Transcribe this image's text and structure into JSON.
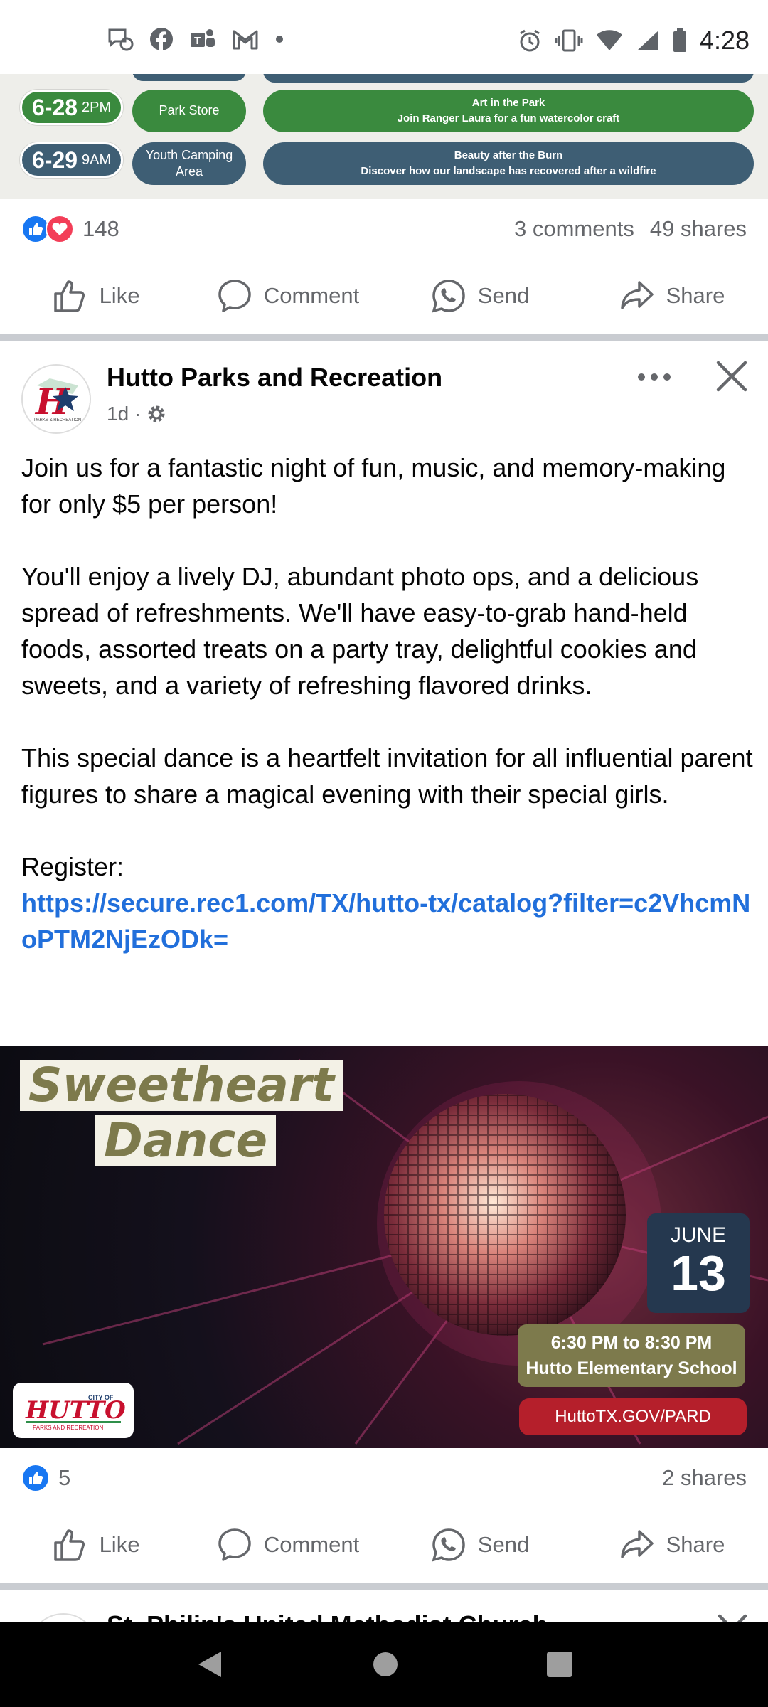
{
  "status_bar": {
    "time": "4:28",
    "left_icons": [
      "messenger-icon",
      "facebook-icon",
      "teams-icon",
      "gmail-icon",
      "dot-icon"
    ],
    "right_icons": [
      "alarm-icon",
      "vibrate-icon",
      "wifi-icon",
      "signal-icon",
      "battery-icon"
    ]
  },
  "prev_post": {
    "schedule": [
      {
        "date": "6-28",
        "time": "2PM",
        "location": "Park Store",
        "title": "Art in the Park",
        "desc": "Join Ranger Laura for a fun watercolor craft"
      },
      {
        "date": "6-29",
        "time": "9AM",
        "location": "Youth Camping Area",
        "title": "Beauty after the Burn",
        "desc": "Discover how our landscape has recovered after a wildfire"
      }
    ],
    "reaction_count": "148",
    "comments": "3 comments",
    "shares": "49 shares"
  },
  "actions": {
    "like": "Like",
    "comment": "Comment",
    "send": "Send",
    "share": "Share"
  },
  "post": {
    "author": "Hutto Parks and Recreation",
    "time": "1d ·",
    "paragraphs": [
      "Join us for a fantastic night of fun, music, and memory-making for only $5 per person!",
      "You'll enjoy a lively DJ, abundant photo ops, and a delicious spread of refreshments. We'll have easy-to-grab hand-held foods, assorted treats on a party tray, delightful cookies and sweets, and a variety of refreshing flavored drinks.",
      "This special dance is a heartfelt invitation for all influential parent figures to share a magical evening with their special girls."
    ],
    "register_label": "Register:",
    "register_link": "https://secure.rec1.com/TX/hutto-tx/catalog?filter=c2VhcmNoPTM2NjEzODk=",
    "image": {
      "title_line1": "Sweetheart",
      "title_line2": "Dance",
      "month": "JUNE",
      "day": "13",
      "time": "6:30 PM to 8:30 PM",
      "venue": "Hutto Elementary School",
      "url": "HuttoTX.GOV/PARD",
      "logo_text": "HUTTO",
      "logo_small": "CITY OF",
      "logo_sub": "PARKS AND RECREATION"
    },
    "reaction_count": "5",
    "shares": "2 shares"
  },
  "next_post": {
    "author": "St. Philip's United Methodist Church"
  },
  "colors": {
    "facebook_blue": "#1877f2",
    "link_blue": "#216fdb",
    "meta_gray": "#65676b"
  }
}
